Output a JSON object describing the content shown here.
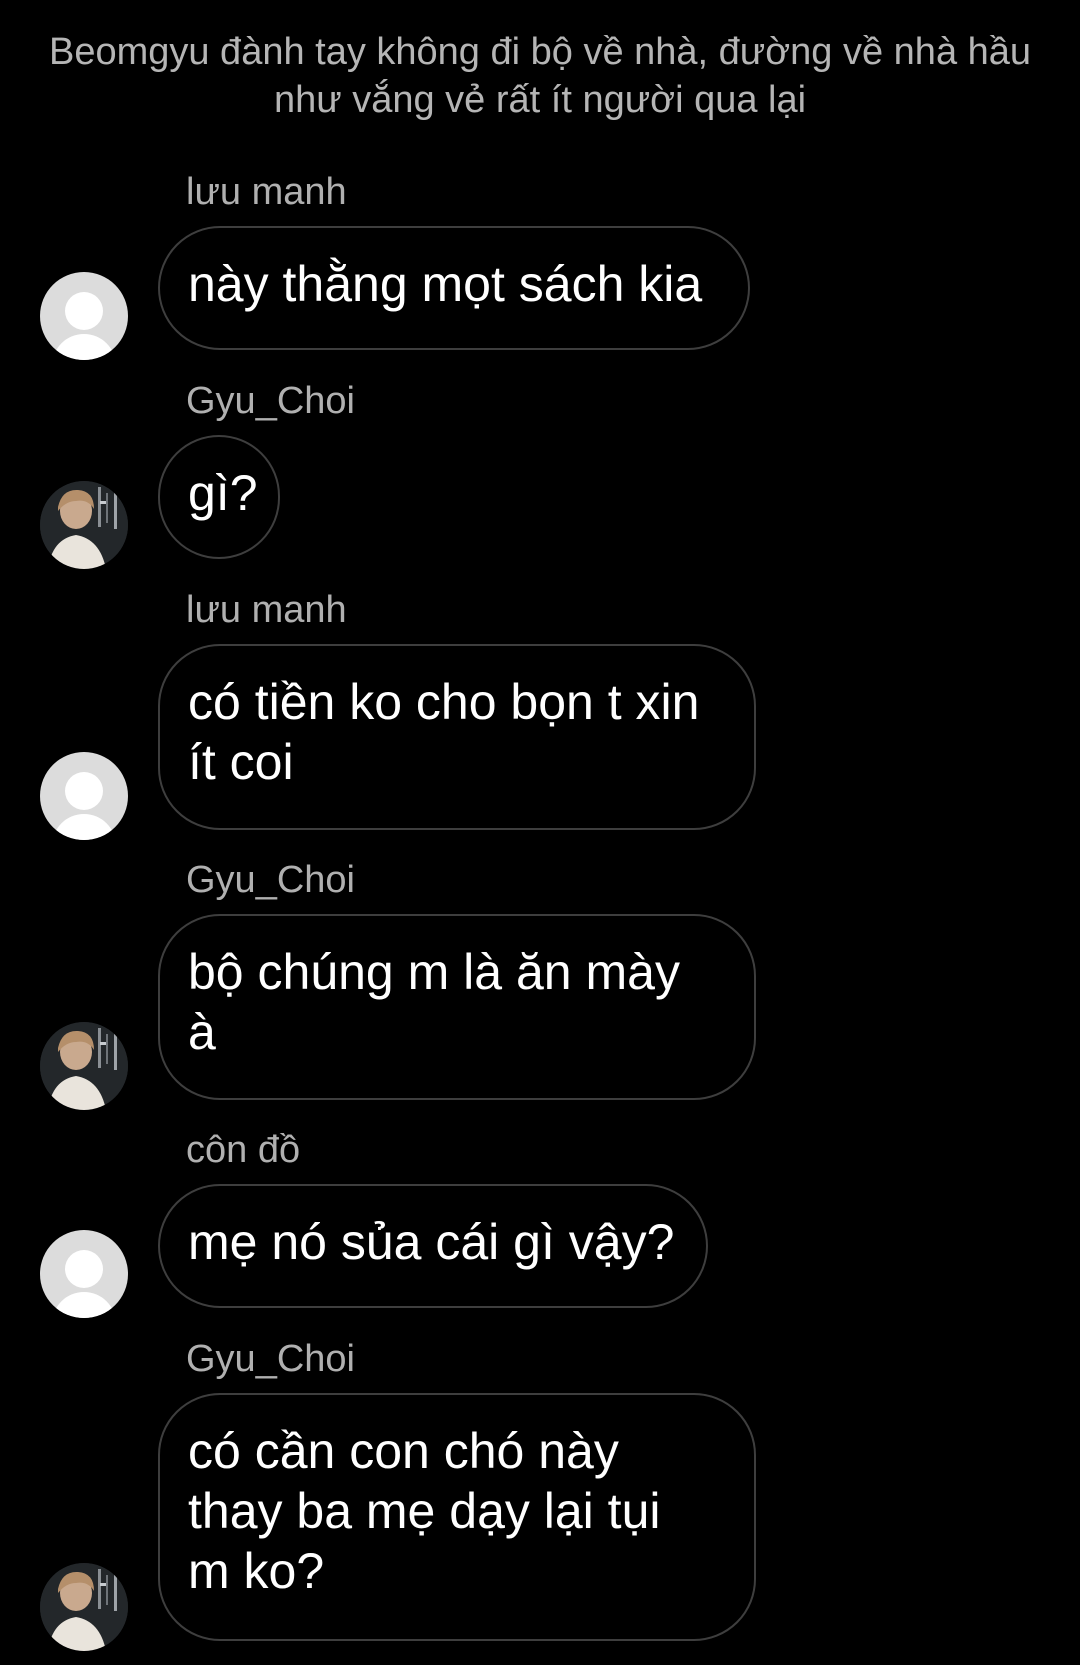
{
  "narration": "Beomgyu đành tay không đi bộ về nhà, đường về nhà hầu như vắng vẻ rất ít người qua lại",
  "messages": [
    {
      "sender": "lưu manh",
      "avatar": "default-user-icon",
      "lines": [
        "này thằng mọt sách kia"
      ]
    },
    {
      "sender": "Gyu_Choi",
      "avatar": "profile-photo",
      "lines": [
        "gì?"
      ]
    },
    {
      "sender": "lưu manh",
      "avatar": "default-user-icon",
      "lines": [
        "có tiền ko cho bọn t xin",
        "ít coi"
      ]
    },
    {
      "sender": "Gyu_Choi",
      "avatar": "profile-photo",
      "lines": [
        "bộ chúng m là ăn mày",
        "à"
      ]
    },
    {
      "sender": "côn đồ",
      "avatar": "default-user-icon",
      "lines": [
        "mẹ nó sủa cái gì vậy?"
      ]
    },
    {
      "sender": "Gyu_Choi",
      "avatar": "profile-photo",
      "lines": [
        "có cần con chó này",
        "thay ba mẹ dạy lại tụi",
        "m ko?"
      ]
    }
  ],
  "colors": {
    "background": "#000000",
    "bubble_border": "#3e3e3e",
    "sender_text": "#b0b0b0",
    "narration_text": "#b5b5b5",
    "message_text": "#ffffff"
  }
}
